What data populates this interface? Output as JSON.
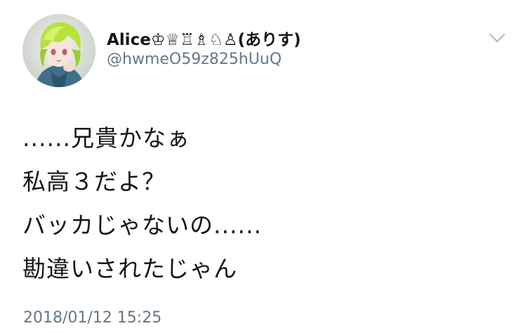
{
  "author": {
    "display_name": "Alice♔♕♖♗♘♙(ありす)",
    "handle": "@hwmeO59z825hUuQ",
    "avatar_icon": "profile-avatar"
  },
  "menu": {
    "icon": "chevron-down-icon",
    "color": "#aab8c2"
  },
  "tweet": {
    "lines": [
      "......兄貴かなぁ",
      "私高３だよ？",
      "バッカじゃないの......",
      "勘違いされたじゃん"
    ],
    "timestamp": "2018/01/12 15:25"
  },
  "colors": {
    "text": "#14171a",
    "secondary": "#657786"
  }
}
